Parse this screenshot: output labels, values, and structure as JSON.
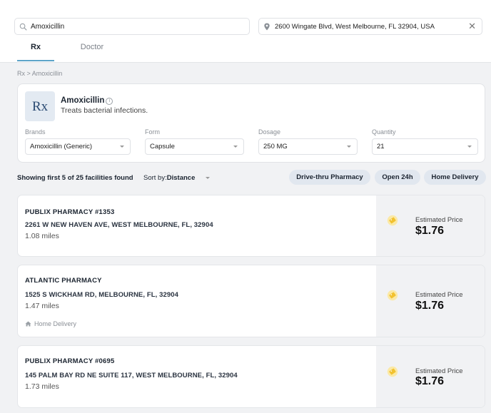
{
  "search": {
    "value": "Amoxicillin",
    "placeholder": ""
  },
  "location": {
    "value": "2600 Wingate Blvd, West Melbourne, FL 32904, USA"
  },
  "tabs": [
    {
      "label": "Rx",
      "active": true
    },
    {
      "label": "Doctor",
      "active": false
    }
  ],
  "breadcrumb": "Rx > Amoxicillin",
  "drug": {
    "name": "Amoxicillin",
    "description": "Treats bacterial infections.",
    "logo_text": "Rx",
    "fields": [
      {
        "label": "Brands",
        "value": "Amoxicillin (Generic)"
      },
      {
        "label": "Form",
        "value": "Capsule"
      },
      {
        "label": "Dosage",
        "value": "250 MG"
      },
      {
        "label": "Quantity",
        "value": "21"
      }
    ]
  },
  "results": {
    "summary": "Showing first 5 of 25 facilities found",
    "sort_prefix": "Sort by:",
    "sort_value": "Distance"
  },
  "filters": [
    "Drive-thru Pharmacy",
    "Open 24h",
    "Home Delivery"
  ],
  "pharmacies": [
    {
      "name": "PUBLIX PHARMACY #1353",
      "address": "2261 W NEW HAVEN AVE, WEST MELBOURNE, FL, 32904",
      "distance": "1.08 miles",
      "feature": "",
      "price_label": "Estimated Price",
      "price": "$1.76"
    },
    {
      "name": "ATLANTIC PHARMACY",
      "address": "1525 S WICKHAM RD, MELBOURNE, FL, 32904",
      "distance": "1.47 miles",
      "feature": "Home Delivery",
      "price_label": "Estimated Price",
      "price": "$1.76"
    },
    {
      "name": "PUBLIX PHARMACY #0695",
      "address": "145 PALM BAY RD NE SUITE 117, WEST MELBOURNE, FL, 32904",
      "distance": "1.73 miles",
      "feature": "",
      "price_label": "Estimated Price",
      "price": "$1.76"
    }
  ],
  "colors": {
    "accent": "#5da4c9",
    "chip_bg": "#e1e7ef",
    "coupon": "#f2c230",
    "page_bg": "#f1f2f4"
  }
}
